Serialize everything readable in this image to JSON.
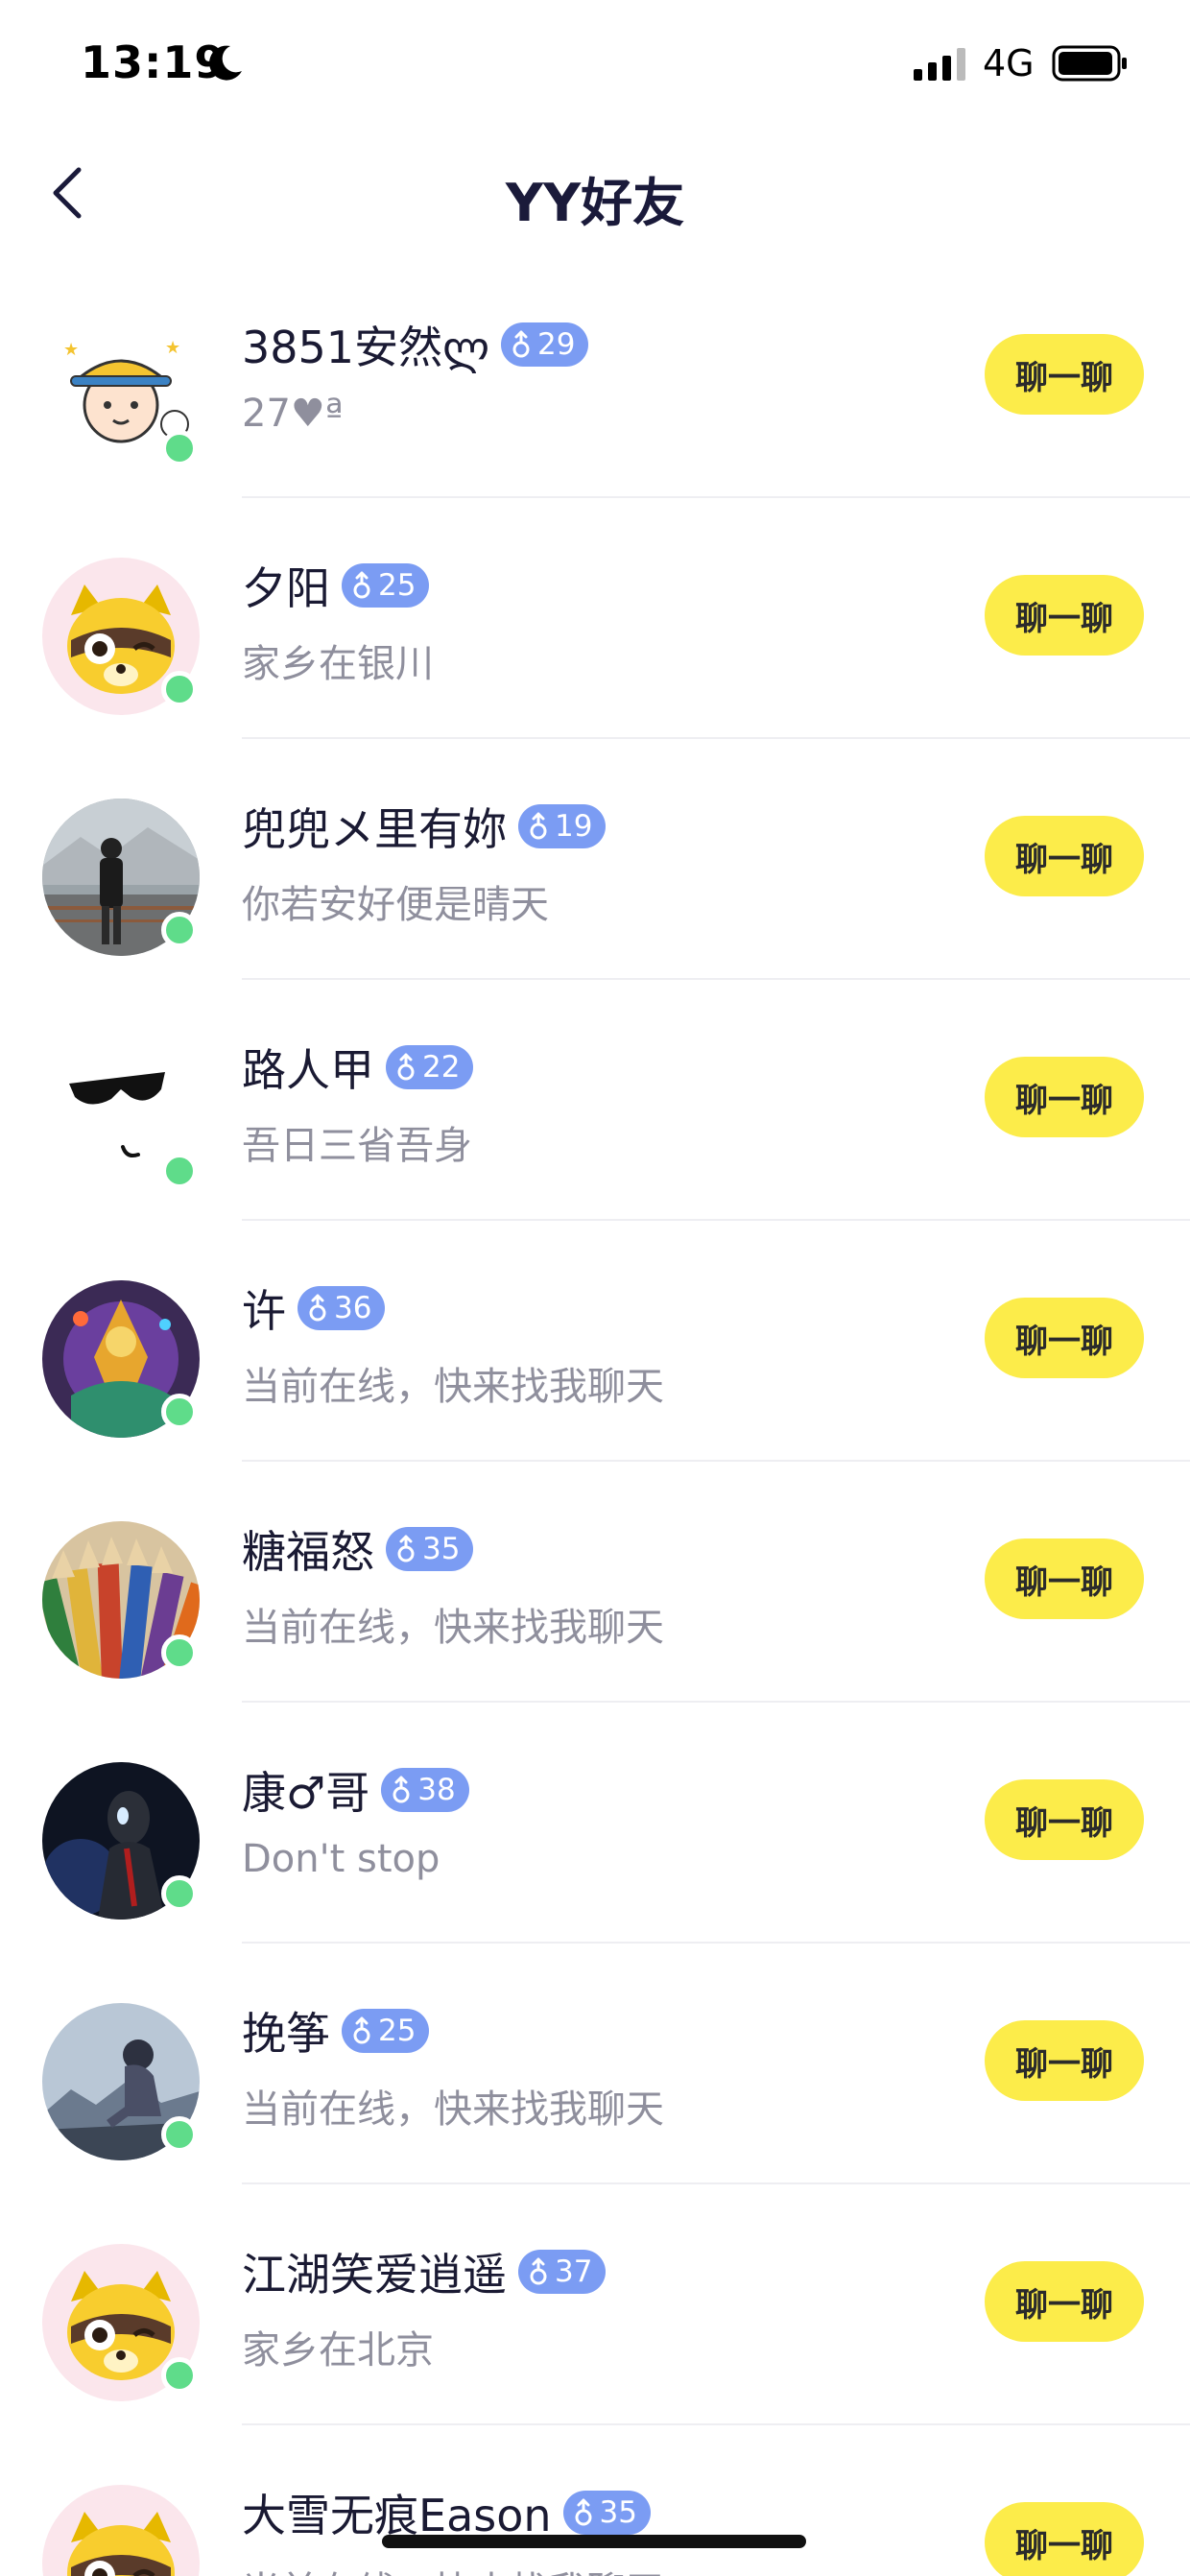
{
  "status_bar": {
    "time": "13:19",
    "network": "4G"
  },
  "nav": {
    "title": "YY好友"
  },
  "chat_label": "聊一聊",
  "friends": [
    {
      "name": "3851安然ლ",
      "age": "29",
      "subtitle": "27♥ª"
    },
    {
      "name": "夕阳",
      "age": "25",
      "subtitle": "家乡在银川"
    },
    {
      "name": "兜兜メ里有妳",
      "age": "19",
      "subtitle": "你若安好便是晴天"
    },
    {
      "name": "路人甲",
      "age": "22",
      "subtitle": "吾日三省吾身"
    },
    {
      "name": "许",
      "age": "36",
      "subtitle": "当前在线，快来找我聊天"
    },
    {
      "name": "糖福怒",
      "age": "35",
      "subtitle": "当前在线，快来找我聊天"
    },
    {
      "name": "康♂哥",
      "age": "38",
      "subtitle": "Don't stop"
    },
    {
      "name": "挽筝",
      "age": "25",
      "subtitle": "当前在线，快来找我聊天"
    },
    {
      "name": "江湖笑爱逍遥",
      "age": "37",
      "subtitle": "家乡在北京"
    },
    {
      "name": "大雪无痕Eason",
      "age": "35",
      "subtitle": "当前在线，快来找我聊天"
    }
  ]
}
